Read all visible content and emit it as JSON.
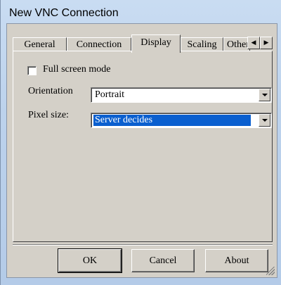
{
  "window": {
    "title": "New VNC Connection"
  },
  "tabs": [
    {
      "label": "General",
      "active": false
    },
    {
      "label": "Connection",
      "active": false
    },
    {
      "label": "Display",
      "active": true
    },
    {
      "label": "Scaling",
      "active": false
    },
    {
      "label": "Other",
      "active": false
    }
  ],
  "tab_scroll": {
    "left_icon": "triangle-left-icon",
    "right_icon": "triangle-right-icon"
  },
  "display": {
    "fullscreen_label": "Full screen mode",
    "fullscreen_checked": false,
    "orientation_label": "Orientation",
    "orientation_value": "Portrait",
    "pixel_size_label": "Pixel size:",
    "pixel_size_value": "Server decides"
  },
  "buttons": {
    "ok": "OK",
    "cancel": "Cancel",
    "about": "About"
  },
  "colors": {
    "selection": "#0a5fcf",
    "face": "#d4d0c8"
  }
}
